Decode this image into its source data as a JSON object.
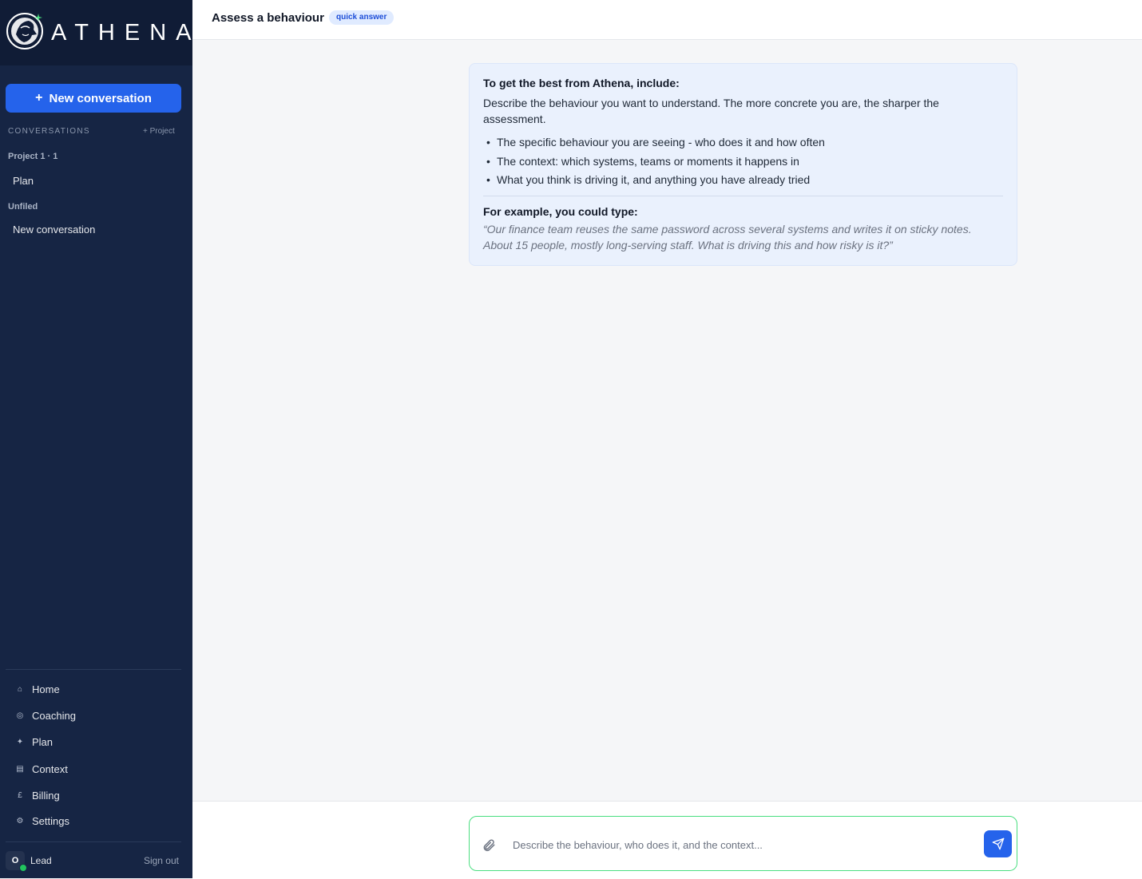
{
  "app": {
    "brand": "ATHENA"
  },
  "sidebar": {
    "new_conversation_label": "New conversation",
    "conversations_heading": "CONVERSATIONS",
    "add_project_label": "+ Project",
    "groups": [
      {
        "label": "Project 1 · 1",
        "items": [
          "Plan"
        ]
      },
      {
        "label": "Unfiled",
        "items": [
          "New conversation"
        ]
      }
    ],
    "nav": [
      {
        "icon": "home-icon",
        "glyph": "⌂",
        "label": "Home"
      },
      {
        "icon": "coaching-icon",
        "glyph": "◎",
        "label": "Coaching"
      },
      {
        "icon": "plan-icon",
        "glyph": "✦",
        "label": "Plan"
      },
      {
        "icon": "context-icon",
        "glyph": "▤",
        "label": "Context"
      },
      {
        "icon": "billing-icon",
        "glyph": "£",
        "label": "Billing"
      },
      {
        "icon": "settings-icon",
        "glyph": "⚙",
        "label": "Settings"
      }
    ],
    "user": {
      "initial": "O",
      "role": "Lead",
      "sign_out_label": "Sign out"
    }
  },
  "header": {
    "title": "Assess a behaviour",
    "badge": "quick answer"
  },
  "guidance": {
    "heading": "To get the best from Athena, include:",
    "intro": "Describe the behaviour you want to understand. The more concrete you are, the sharper the assessment.",
    "bullets": [
      "The specific behaviour you are seeing - who does it and how often",
      "The context: which systems, teams or moments it happens in",
      "What you think is driving it, and anything you have already tried"
    ],
    "example_heading": "For example, you could type:",
    "example_text": "“Our finance team reuses the same password across several systems and writes it on sticky notes. About 15 people, mostly long-serving staff. What is driving this and how risky is it?”"
  },
  "composer": {
    "placeholder": "Describe the behaviour, who does it, and the context...",
    "value": ""
  },
  "colors": {
    "sidebar_bg": "#162544",
    "logo_bg": "#101c36",
    "accent": "#2563eb",
    "card_bg": "#eaf1fd",
    "composer_border": "#4ade80",
    "online": "#22c55e"
  }
}
